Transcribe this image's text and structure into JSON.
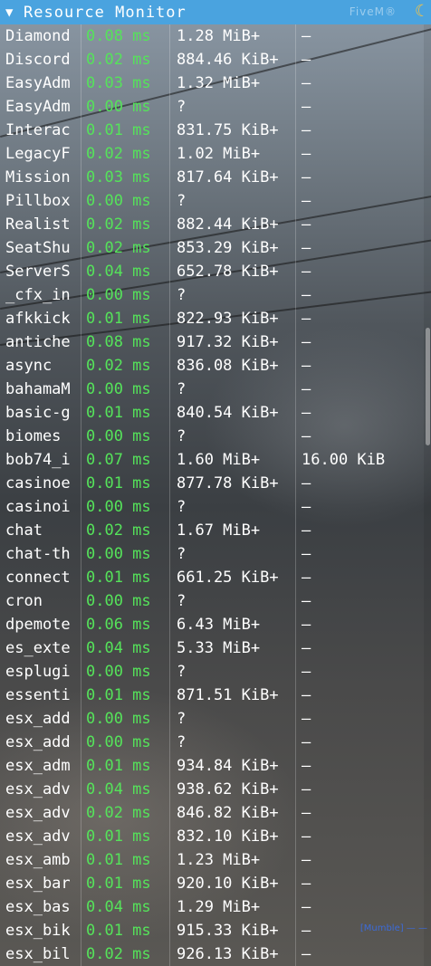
{
  "window": {
    "title": "Resource Monitor",
    "collapse_glyph": "▼",
    "brand_text": "FiveM®",
    "brand_icon": "moon-icon"
  },
  "overlay_label": "[Mumble] — —",
  "rows": [
    {
      "name": "Diamond",
      "time": "0.08 ms",
      "memory": "1.28 MiB+",
      "streaming": "–"
    },
    {
      "name": "Discord",
      "time": "0.02 ms",
      "memory": "884.46 KiB+",
      "streaming": "–"
    },
    {
      "name": "EasyAdm",
      "time": "0.03 ms",
      "memory": "1.32 MiB+",
      "streaming": "–"
    },
    {
      "name": "EasyAdm",
      "time": "0.00 ms",
      "memory": "?",
      "streaming": "–"
    },
    {
      "name": "Interac",
      "time": "0.01 ms",
      "memory": "831.75 KiB+",
      "streaming": "–"
    },
    {
      "name": "LegacyF",
      "time": "0.02 ms",
      "memory": "1.02 MiB+",
      "streaming": "–"
    },
    {
      "name": "Mission",
      "time": "0.03 ms",
      "memory": "817.64 KiB+",
      "streaming": "–"
    },
    {
      "name": "Pillbox",
      "time": "0.00 ms",
      "memory": "?",
      "streaming": "–"
    },
    {
      "name": "Realist",
      "time": "0.02 ms",
      "memory": "882.44 KiB+",
      "streaming": "–"
    },
    {
      "name": "SeatShu",
      "time": "0.02 ms",
      "memory": "853.29 KiB+",
      "streaming": "–"
    },
    {
      "name": "ServerS",
      "time": "0.04 ms",
      "memory": "652.78 KiB+",
      "streaming": "–"
    },
    {
      "name": "_cfx_in",
      "time": "0.00 ms",
      "memory": "?",
      "streaming": "–"
    },
    {
      "name": "afkkick",
      "time": "0.01 ms",
      "memory": "822.93 KiB+",
      "streaming": "–"
    },
    {
      "name": "antiche",
      "time": "0.08 ms",
      "memory": "917.32 KiB+",
      "streaming": "–"
    },
    {
      "name": "async",
      "time": "0.02 ms",
      "memory": "836.08 KiB+",
      "streaming": "–"
    },
    {
      "name": "bahamaM",
      "time": "0.00 ms",
      "memory": "?",
      "streaming": "–"
    },
    {
      "name": "basic-g",
      "time": "0.01 ms",
      "memory": "840.54 KiB+",
      "streaming": "–"
    },
    {
      "name": "biomes",
      "time": "0.00 ms",
      "memory": "?",
      "streaming": "–"
    },
    {
      "name": "bob74_i",
      "time": "0.07 ms",
      "memory": "1.60 MiB+",
      "streaming": "16.00 KiB"
    },
    {
      "name": "casinoe",
      "time": "0.01 ms",
      "memory": "877.78 KiB+",
      "streaming": "–"
    },
    {
      "name": "casinoi",
      "time": "0.00 ms",
      "memory": "?",
      "streaming": "–"
    },
    {
      "name": "chat",
      "time": "0.02 ms",
      "memory": "1.67 MiB+",
      "streaming": "–"
    },
    {
      "name": "chat-th",
      "time": "0.00 ms",
      "memory": "?",
      "streaming": "–"
    },
    {
      "name": "connect",
      "time": "0.01 ms",
      "memory": "661.25 KiB+",
      "streaming": "–"
    },
    {
      "name": "cron",
      "time": "0.00 ms",
      "memory": "?",
      "streaming": "–"
    },
    {
      "name": "dpemote",
      "time": "0.06 ms",
      "memory": "6.43 MiB+",
      "streaming": "–"
    },
    {
      "name": "es_exte",
      "time": "0.04 ms",
      "memory": "5.33 MiB+",
      "streaming": "–"
    },
    {
      "name": "esplugi",
      "time": "0.00 ms",
      "memory": "?",
      "streaming": "–"
    },
    {
      "name": "essenti",
      "time": "0.01 ms",
      "memory": "871.51 KiB+",
      "streaming": "–"
    },
    {
      "name": "esx_add",
      "time": "0.00 ms",
      "memory": "?",
      "streaming": "–"
    },
    {
      "name": "esx_add",
      "time": "0.00 ms",
      "memory": "?",
      "streaming": "–"
    },
    {
      "name": "esx_adm",
      "time": "0.01 ms",
      "memory": "934.84 KiB+",
      "streaming": "–"
    },
    {
      "name": "esx_adv",
      "time": "0.04 ms",
      "memory": "938.62 KiB+",
      "streaming": "–"
    },
    {
      "name": "esx_adv",
      "time": "0.02 ms",
      "memory": "846.82 KiB+",
      "streaming": "–"
    },
    {
      "name": "esx_adv",
      "time": "0.01 ms",
      "memory": "832.10 KiB+",
      "streaming": "–"
    },
    {
      "name": "esx_amb",
      "time": "0.01 ms",
      "memory": "1.23 MiB+",
      "streaming": "–"
    },
    {
      "name": "esx_bar",
      "time": "0.01 ms",
      "memory": "920.10 KiB+",
      "streaming": "–"
    },
    {
      "name": "esx_bas",
      "time": "0.04 ms",
      "memory": "1.29 MiB+",
      "streaming": "–"
    },
    {
      "name": "esx_bik",
      "time": "0.01 ms",
      "memory": "915.33 KiB+",
      "streaming": "–"
    },
    {
      "name": "esx_bil",
      "time": "0.02 ms",
      "memory": "926.13 KiB+",
      "streaming": "–"
    }
  ]
}
